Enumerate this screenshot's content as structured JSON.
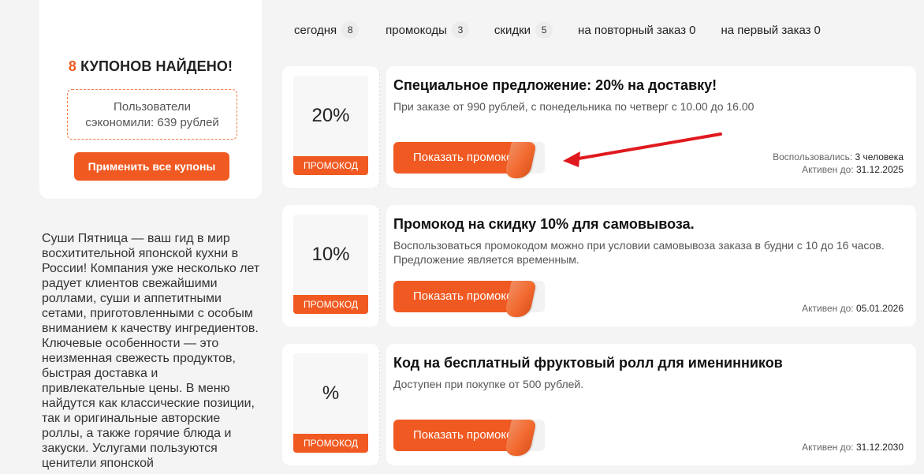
{
  "summary": {
    "found_count": "8",
    "found_text": " КУПОНОВ НАЙДЕНО!",
    "saved_line1": "Пользователи",
    "saved_line2": "сэкономили: 639 рублей",
    "apply_all_label": "Применить все купоны"
  },
  "description": "Суши Пятница — ваш гид в мир восхитительной японской кухни в России! Компания уже несколько лет радует клиентов свежайшими роллами, суши и аппетитными сетами, приготовленными с особым вниманием к качеству ингредиентов. Ключевые особенности — это неизменная свежесть продуктов, быстрая доставка и привлекательные цены. В меню найдутся как классические позиции, так и оригинальные авторские роллы, а также горячие блюда и закуски. Услугами пользуются ценители японской",
  "tabs": [
    {
      "label": "сегодня",
      "count": "8"
    },
    {
      "label": "промокоды",
      "count": "3"
    },
    {
      "label": "скидки",
      "count": "5"
    },
    {
      "label": "на повторный заказ",
      "count": "0"
    },
    {
      "label": "на первый заказ",
      "count": "0"
    }
  ],
  "coupons": [
    {
      "discount": "20%",
      "tag": "ПРОМОКОД",
      "title": "Специальное предложение: 20% на доставку!",
      "description": "При заказе от 990 рублей, с понедельника по четверг с 10.00 до 16.00",
      "button_label": "Показать промокод",
      "used_label": "Воспользовались:",
      "used_value": "3 человека",
      "active_label": "Активен до:",
      "active_value": "31.12.2025"
    },
    {
      "discount": "10%",
      "tag": "ПРОМОКОД",
      "title": "Промокод на скидку 10% для самовывоза.",
      "description": "Воспользоваться промокодом можно при условии самовывоза заказа в будни с 10 до 16 часов. Предложение является временным.",
      "button_label": "Показать промокод",
      "active_label": "Активен до:",
      "active_value": "05.01.2026"
    },
    {
      "discount": "%",
      "tag": "ПРОМОКОД",
      "title": "Код на бесплатный фруктовый ролл для именинников",
      "description": "Доступен при покупке от 500 рублей.",
      "button_label": "Показать промокод",
      "active_label": "Активен до:",
      "active_value": "31.12.2030"
    }
  ],
  "colors": {
    "accent": "#f05a22",
    "annotation_arrow": "#e0191f"
  }
}
